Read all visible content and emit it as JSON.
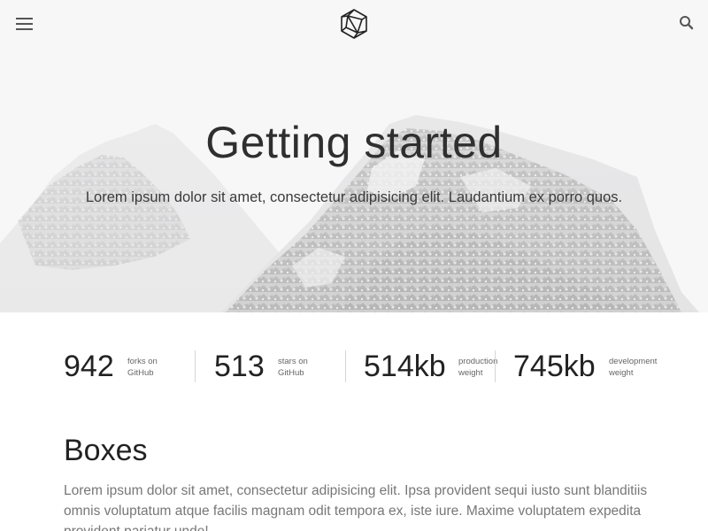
{
  "header": {
    "menu_icon": "hamburger-menu-icon",
    "logo_icon": "polyhedron-logo-icon",
    "search_icon": "search-icon"
  },
  "hero": {
    "title": "Getting started",
    "subtitle": "Lorem ipsum dolor sit amet, consectetur adipisicing elit. Laudantium ex porro quos."
  },
  "stats": [
    {
      "value": "942",
      "label_line1": "forks on",
      "label_line2": "GitHub"
    },
    {
      "value": "513",
      "label_line1": "stars on",
      "label_line2": "GitHub"
    },
    {
      "value": "514kb",
      "label_line1": "production",
      "label_line2": "weight"
    },
    {
      "value": "745kb",
      "label_line1": "development",
      "label_line2": "weight"
    }
  ],
  "boxes": {
    "title": "Boxes",
    "body": "Lorem ipsum dolor sit amet, consectetur adipisicing elit. Ipsa provident sequi iusto sunt blanditiis omnis voluptatum atque facilis magnam odit tempora ex, iste iure. Maxime voluptatem expedita provident pariatur unde!"
  },
  "colors": {
    "text_dark": "#2f2f2f",
    "text_muted": "#777777",
    "hero_bg": "#f7f7f8",
    "divider": "#d6d6d6"
  }
}
